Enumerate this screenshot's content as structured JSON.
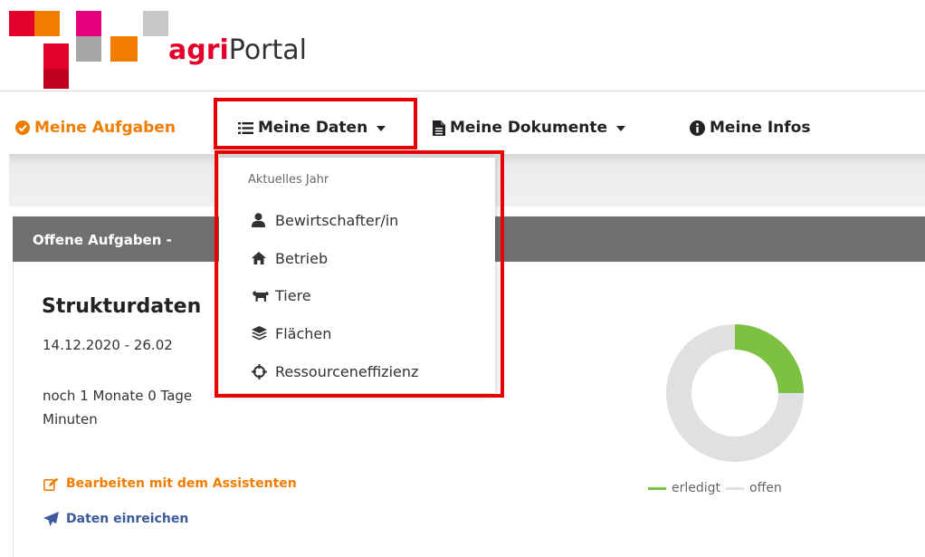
{
  "logo": {
    "brand_bold": "agri",
    "brand_rest": "Portal",
    "colors": [
      "#e3002b",
      "#f07d00",
      "#e6007e",
      "#a6a6a6",
      "#c8c8c8"
    ]
  },
  "nav": {
    "items": [
      {
        "label": "Meine Aufgaben",
        "icon": "check-circle-icon",
        "color": "#f07d00"
      },
      {
        "label": "Meine Daten",
        "icon": "list-icon",
        "dropdown": true
      },
      {
        "label": "Meine Dokumente",
        "icon": "document-icon",
        "dropdown": true
      },
      {
        "label": "Meine Infos",
        "icon": "info-circle-icon"
      }
    ]
  },
  "dropdown": {
    "header": "Aktuelles Jahr",
    "items": [
      {
        "label": "Bewirtschafter/in",
        "icon": "user-icon"
      },
      {
        "label": "Betrieb",
        "icon": "home-icon"
      },
      {
        "label": "Tiere",
        "icon": "cow-icon"
      },
      {
        "label": "Flächen",
        "icon": "layers-icon"
      },
      {
        "label": "Ressourceneffizienz",
        "icon": "crosshairs-icon"
      }
    ]
  },
  "panel": {
    "header": "Offene Aufgaben -",
    "task": {
      "title": "Strukturdaten",
      "date_range": "14.12.2020 - 26.02",
      "remaining": "noch 1 Monate 0 Tage",
      "remaining_line2": "Minuten",
      "actions": [
        {
          "label": "Bearbeiten mit dem Assistenten",
          "icon": "edit-icon",
          "color": "#f07d00"
        },
        {
          "label": "Daten einreichen",
          "icon": "send-icon",
          "color": "#3a5a9b"
        }
      ]
    },
    "progress": {
      "done_fraction": 0.25,
      "done_color": "#7dc142",
      "open_color": "#e0e0e0"
    },
    "legend": [
      {
        "label": "erledigt",
        "color": "#7dc142"
      },
      {
        "label": "offen",
        "color": "#e0e0e0"
      }
    ]
  },
  "highlight_color": "#e60000"
}
